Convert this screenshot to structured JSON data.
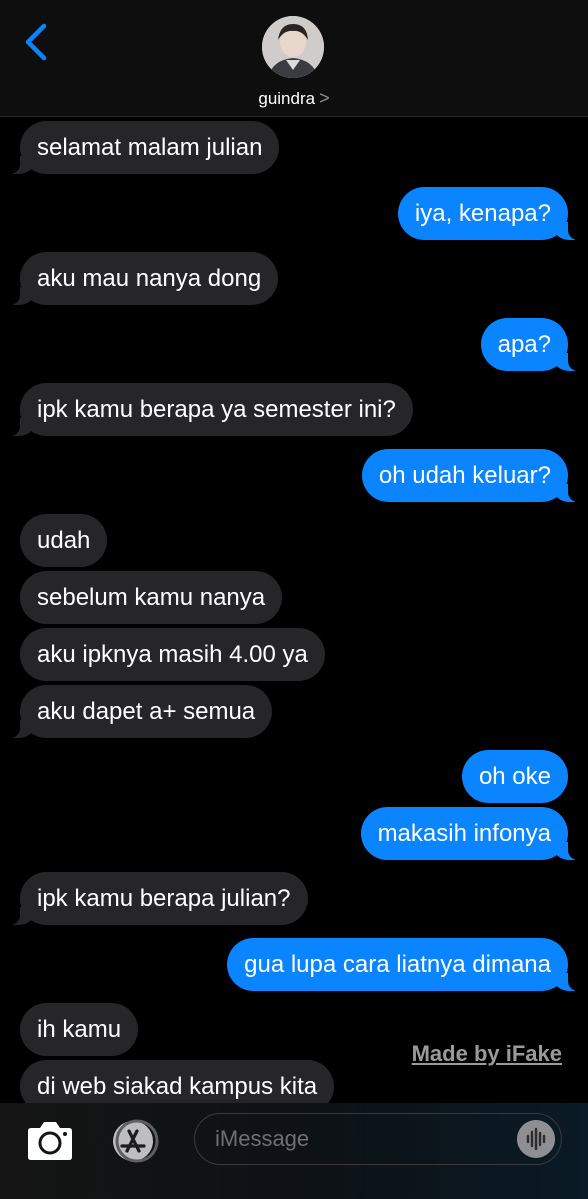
{
  "header": {
    "contact_name": "guindra",
    "chevron": ">",
    "back_icon": "chevron-left-icon",
    "accent": "#0a84ff"
  },
  "messages": [
    {
      "text": "selamat malam julian",
      "from": "them"
    },
    {
      "text": "iya, kenapa?",
      "from": "me"
    },
    {
      "text": "aku mau nanya dong",
      "from": "them"
    },
    {
      "text": "apa?",
      "from": "me"
    },
    {
      "text": "ipk kamu berapa ya semester ini?",
      "from": "them"
    },
    {
      "text": "oh udah keluar?",
      "from": "me"
    },
    {
      "text": "udah",
      "from": "them"
    },
    {
      "text": "sebelum kamu nanya",
      "from": "them"
    },
    {
      "text": "aku ipknya masih 4.00 ya",
      "from": "them"
    },
    {
      "text": "aku dapet a+ semua",
      "from": "them"
    },
    {
      "text": "oh oke",
      "from": "me"
    },
    {
      "text": "makasih infonya",
      "from": "me"
    },
    {
      "text": "ipk kamu berapa julian?",
      "from": "them"
    },
    {
      "text": "gua lupa cara liatnya dimana",
      "from": "me"
    },
    {
      "text": "ih kamu",
      "from": "them"
    },
    {
      "text": "di web siakad kampus kita",
      "from": "them"
    }
  ],
  "watermark": "Made by iFake",
  "composer": {
    "placeholder": "iMessage",
    "camera_icon": "camera-icon",
    "apps_icon": "app-store-icon",
    "audio_icon": "audio-waveform-icon"
  },
  "colors": {
    "incoming_bubble": "#262629",
    "outgoing_bubble": "#0a84ff",
    "background": "#000000"
  }
}
